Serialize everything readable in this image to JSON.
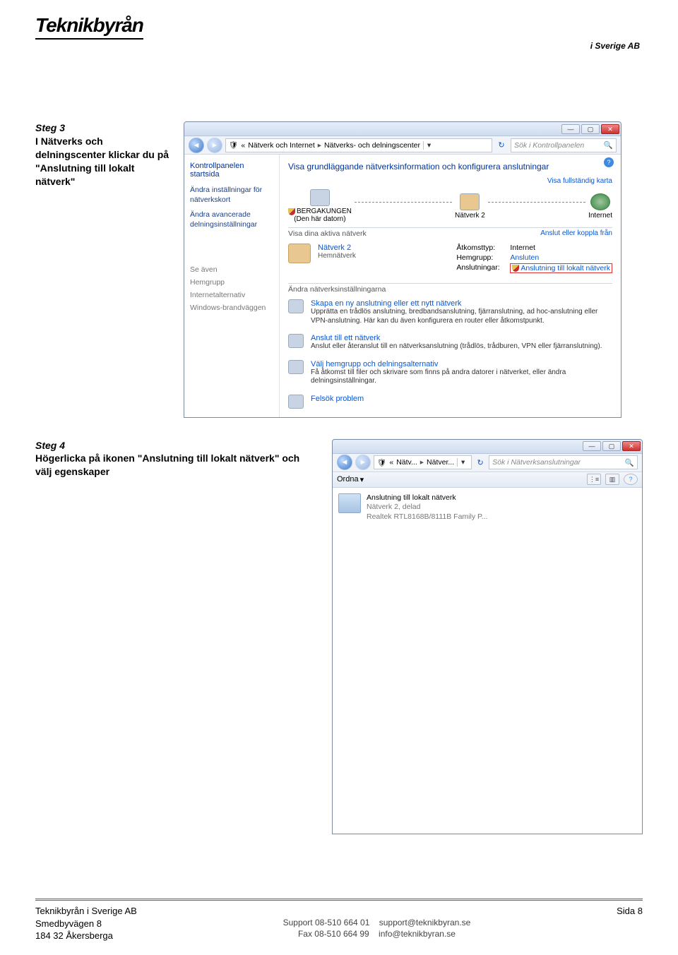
{
  "logo": {
    "main": "Teknikbyrån",
    "sub": "i Sverige AB"
  },
  "step3": {
    "title": "Steg 3",
    "body": "I Nätverks och delningscenter klickar du på \"Anslutning till lokalt nätverk\""
  },
  "step4": {
    "title": "Steg 4",
    "body": "Högerlicka på ikonen \"Anslutning till lokalt nätverk\" och",
    "body2": "välj egenskaper"
  },
  "win1": {
    "breadcrumb": {
      "p1": "Nätverk och Internet",
      "p2": "Nätverks- och delningscenter"
    },
    "search_placeholder": "Sök i Kontrollpanelen",
    "sidebar": {
      "head": "Kontrollpanelen startsida",
      "link1": "Ändra inställningar för nätverkskort",
      "link2": "Ändra avancerade delningsinställningar",
      "see_also": "Se även",
      "sa1": "Hemgrupp",
      "sa2": "Internetalternativ",
      "sa3": "Windows-brandväggen"
    },
    "main": {
      "headline": "Visa grundläggande nätverksinformation och konfigurera anslutningar",
      "full_map": "Visa fullständig karta",
      "node1": "BERGAKUNGEN",
      "node1_sub": "(Den här datorn)",
      "node2": "Nätverk 2",
      "node3": "Internet",
      "active_label": "Visa dina aktiva nätverk",
      "active_link": "Anslut eller koppla från",
      "net_name": "Nätverk 2",
      "net_type": "Hemnätverk",
      "det_key1": "Åtkomsttyp:",
      "det_val1": "Internet",
      "det_key2": "Hemgrupp:",
      "det_val2": "Ansluten",
      "det_key3": "Anslutningar:",
      "det_val3": "Anslutning till lokalt nätverk",
      "change_label": "Ändra nätverksinställningarna",
      "a1_title": "Skapa en ny anslutning eller ett nytt nätverk",
      "a1_desc": "Upprätta en trådlös anslutning, bredbandsanslutning, fjärranslutning, ad hoc-anslutning eller VPN-anslutning. Här kan du även konfigurera en router eller åtkomstpunkt.",
      "a2_title": "Anslut till ett nätverk",
      "a2_desc": "Anslut eller återanslut till en nätverksanslutning (trådlös, trådburen, VPN eller fjärranslutning).",
      "a3_title": "Välj hemgrupp och delningsalternativ",
      "a3_desc": "Få åtkomst till filer och skrivare som finns på andra datorer i nätverket, eller ändra delningsinställningar.",
      "a4_title": "Felsök problem"
    }
  },
  "win2": {
    "breadcrumb": {
      "p1": "Nätv...",
      "p2": "Nätver..."
    },
    "search_placeholder": "Sök i Nätverksanslutningar",
    "toolbar": {
      "ordna": "Ordna"
    },
    "item": {
      "title": "Anslutning till lokalt nätverk",
      "line2": "Nätverk 2, delad",
      "line3": "Realtek RTL8168B/8111B Family P..."
    }
  },
  "footer": {
    "company": "Teknikbyrån i Sverige AB",
    "addr1": "Smedbyvägen 8",
    "addr2": "184 32 Åkersberga",
    "support_label": "Support 08-510 664 01",
    "fax_label": "Fax 08-510 664 99",
    "support_email": "support@teknikbyran.se",
    "info_email": "info@teknikbyran.se",
    "page": "Sida 8"
  }
}
